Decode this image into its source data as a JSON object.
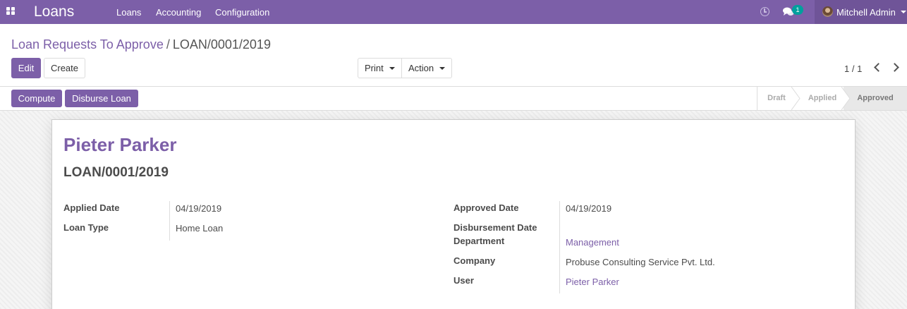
{
  "navbar": {
    "brand": "Loans",
    "menu": [
      "Loans",
      "Accounting",
      "Configuration"
    ],
    "chat_badge": "1",
    "user_name": "Mitchell Admin",
    "icons": [
      "apps-grid-icon",
      "clock-icon",
      "chat-icon",
      "avatar"
    ]
  },
  "breadcrumb": {
    "parent": "Loan Requests To Approve",
    "separator": "/",
    "current": "LOAN/0001/2019"
  },
  "toolbar": {
    "edit_label": "Edit",
    "create_label": "Create",
    "print_label": "Print",
    "action_label": "Action",
    "pager": "1 / 1"
  },
  "statusbar": {
    "compute_label": "Compute",
    "disburse_label": "Disburse Loan",
    "stages": [
      "Draft",
      "Applied",
      "Approved"
    ],
    "active_stage": "Approved"
  },
  "record": {
    "name": "Pieter Parker",
    "reference": "LOAN/0001/2019",
    "left_fields": [
      {
        "label": "Applied Date",
        "value": "04/19/2019"
      },
      {
        "label": "Loan Type",
        "value": "Home Loan"
      }
    ],
    "right_fields": [
      {
        "label": "Approved Date",
        "value": "04/19/2019"
      },
      {
        "label": "Disbursement Date",
        "value": ""
      },
      {
        "label": "Department",
        "value": "Management"
      },
      {
        "label": "Company",
        "value": "Probuse Consulting Service Pvt. Ltd."
      },
      {
        "label": "User",
        "value": "Pieter Parker"
      }
    ]
  },
  "colors": {
    "brand": "#7c5fa8",
    "brand_dark": "#6f5498",
    "badge": "#00a09d",
    "text": "#4c4c4c"
  }
}
